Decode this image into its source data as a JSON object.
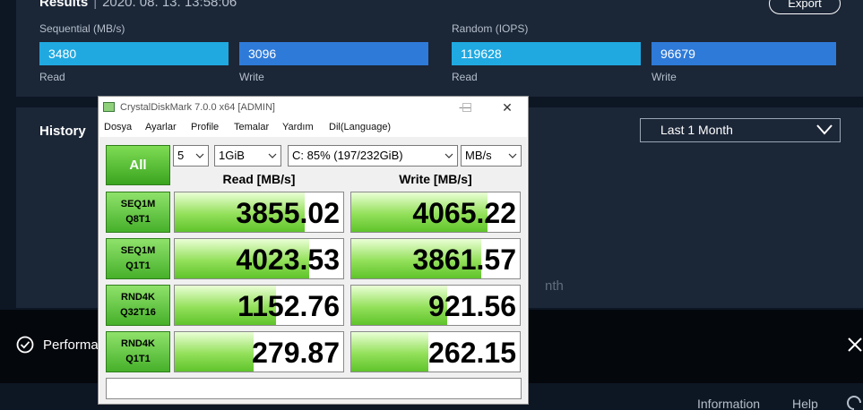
{
  "results": {
    "title": "Results",
    "date": "2020. 08. 13. 13:58:06",
    "export_label": "Export",
    "sequential_label": "Sequential (MB/s)",
    "random_label": "Random (IOPS)",
    "seq_read": "3480",
    "seq_write": "3096",
    "rnd_read": "119628",
    "rnd_write": "96679",
    "read_caption": "Read",
    "write_caption": "Write"
  },
  "history": {
    "title": "History",
    "period": "Last 1 Month",
    "ghost": "nth"
  },
  "notification": {
    "text": "Performa"
  },
  "footer": {
    "information": "Information",
    "help": "Help"
  },
  "cdm": {
    "title": "CrystalDiskMark 7.0.0 x64 [ADMIN]",
    "menu": [
      "Dosya",
      "Ayarlar",
      "Profile",
      "Temalar",
      "Yardım",
      "Dil(Language)"
    ],
    "all_label": "All",
    "count": "5",
    "size": "1GiB",
    "drive": "C: 85% (197/232GiB)",
    "unit": "MB/s",
    "read_header": "Read [MB/s]",
    "write_header": "Write [MB/s]",
    "tests": [
      {
        "line1": "SEQ1M",
        "line2": "Q8T1",
        "read": "3855.02",
        "write": "4065.22",
        "read_fill": 0.77,
        "write_fill": 0.81
      },
      {
        "line1": "SEQ1M",
        "line2": "Q1T1",
        "read": "4023.53",
        "write": "3861.57",
        "read_fill": 0.8,
        "write_fill": 0.77
      },
      {
        "line1": "RND4K",
        "line2": "Q32T16",
        "read": "1152.76",
        "write": "921.56",
        "read_fill": 0.6,
        "write_fill": 0.57
      },
      {
        "line1": "RND4K",
        "line2": "Q1T1",
        "read": "279.87",
        "write": "262.15",
        "read_fill": 0.47,
        "write_fill": 0.46
      }
    ]
  },
  "colors": {
    "bar_read": "#20a9e1",
    "bar_write": "#2e7ad8",
    "cdm_green": "#5fc42b"
  }
}
